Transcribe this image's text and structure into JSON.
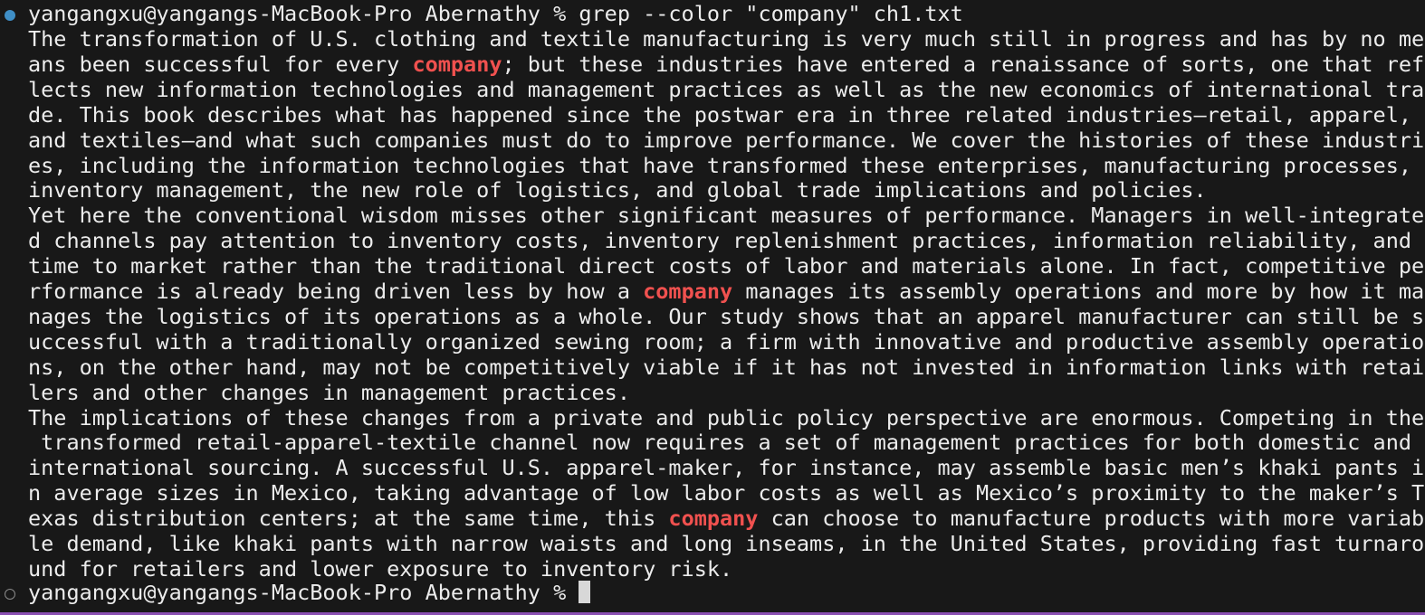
{
  "terminal": {
    "command_prompt": "yangangxu@yangangs-MacBook-Pro Abernathy % ",
    "command": "grep --color \"company\" ch1.txt",
    "match_term": "company",
    "output_lines": [
      "The transformation of U.S. clothing and textile manufacturing is very much still in progress and has by no me",
      "ans been successful for every company; but these industries have entered a renaissance of sorts, one that ref",
      "lects new information technologies and management practices as well as the new economics of international tra",
      "de. This book describes what has happened since the postwar era in three related industries—retail, apparel,",
      "and textiles—and what such companies must do to improve performance. We cover the histories of these industri",
      "es, including the information technologies that have transformed these enterprises, manufacturing processes,",
      "inventory management, the new role of logistics, and global trade implications and policies.",
      "Yet here the conventional wisdom misses other significant measures of performance. Managers in well-integrate",
      "d channels pay attention to inventory costs, inventory replenishment practices, information reliability, and",
      "time to market rather than the traditional direct costs of labor and materials alone. In fact, competitive pe",
      "rformance is already being driven less by how a company manages its assembly operations and more by how it ma",
      "nages the logistics of its operations as a whole. Our study shows that an apparel manufacturer can still be s",
      "uccessful with a traditionally organized sewing room; a firm with innovative and productive assembly operatio",
      "ns, on the other hand, may not be competitively viable if it has not invested in information links with retai",
      "lers and other changes in management practices.",
      "The implications of these changes from a private and public policy perspective are enormous. Competing in the",
      " transformed retail-apparel-textile channel now requires a set of management practices for both domestic and",
      "international sourcing. A successful U.S. apparel-maker, for instance, may assemble basic men’s khaki pants i",
      "n average sizes in Mexico, taking advantage of low labor costs as well as Mexico’s proximity to the maker’s T",
      "exas distribution centers; at the same time, this company can choose to manufacture products with more variab",
      "le demand, like khaki pants with narrow waists and long inseams, in the United States, providing fast turnaro",
      "und for retailers and lower exposure to inventory risk."
    ],
    "final_prompt": "yangangxu@yangangs-MacBook-Pro Abernathy % ",
    "colors": {
      "background": "#181818",
      "text": "#ececec",
      "match": "#f0514f",
      "done_dot": "#3f8fc7",
      "pending_dot": "#8a8a8a",
      "bottom_border": "#8a4fb2"
    }
  }
}
